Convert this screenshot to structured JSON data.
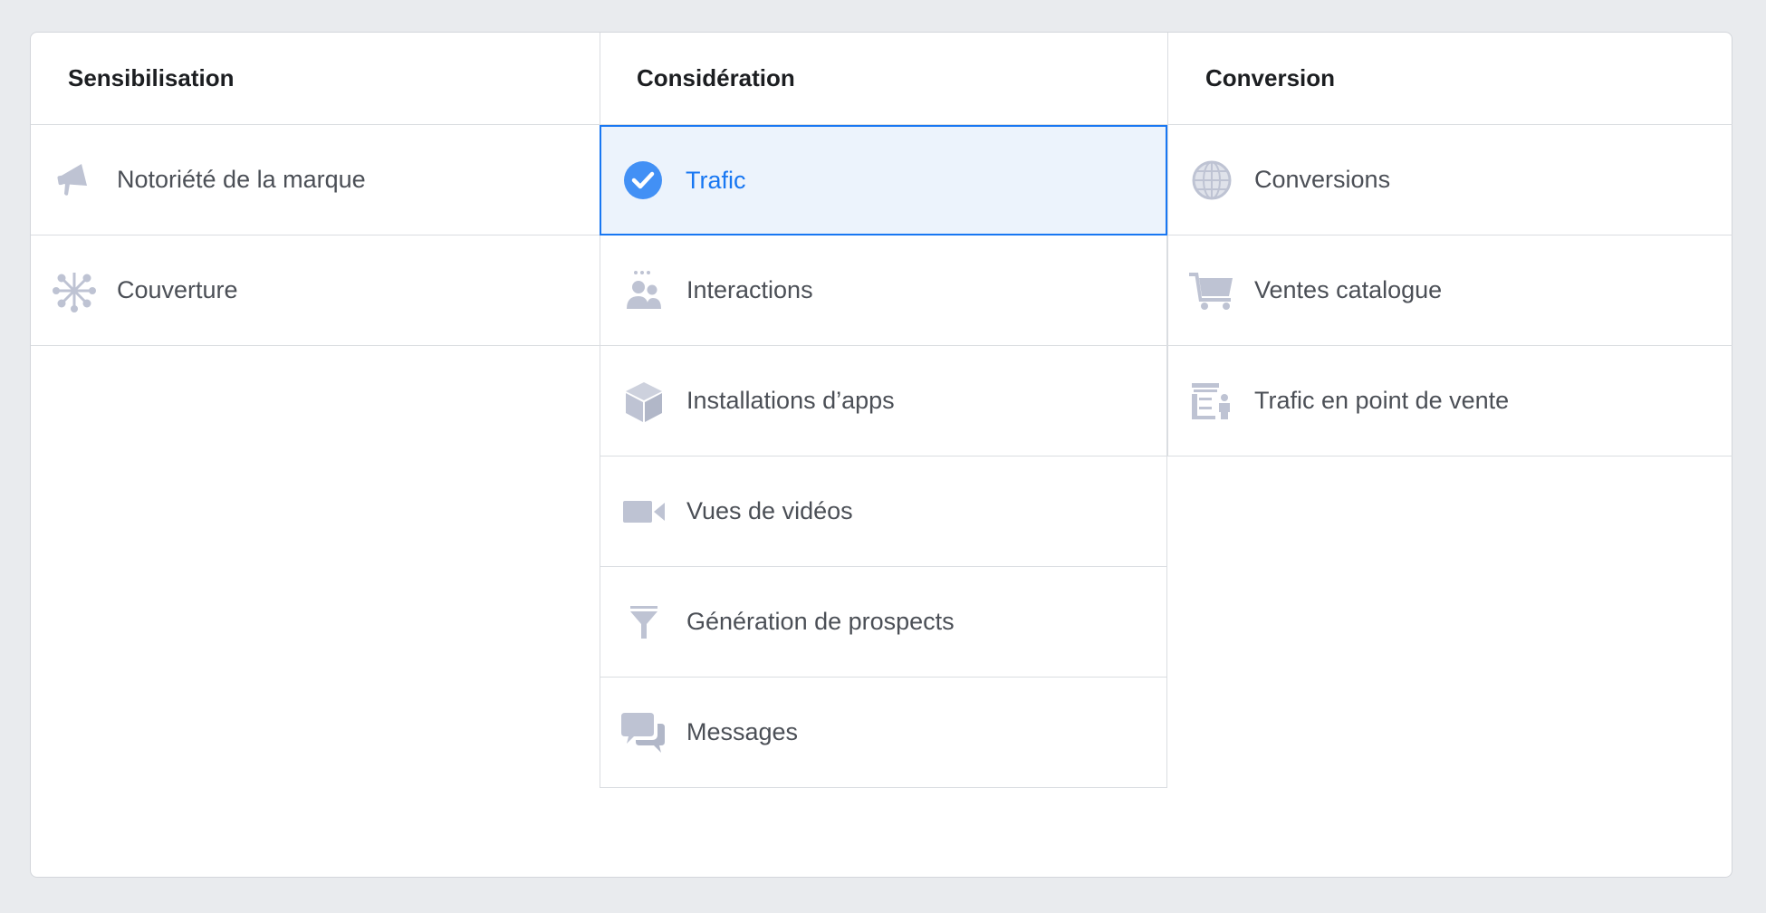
{
  "columns": [
    {
      "header": "Sensibilisation",
      "items": [
        {
          "label": "Notoriété de la marque",
          "icon": "megaphone-icon",
          "selected": false
        },
        {
          "label": "Couverture",
          "icon": "network-icon",
          "selected": false
        }
      ]
    },
    {
      "header": "Considération",
      "items": [
        {
          "label": "Trafic",
          "icon": "check-circle-icon",
          "selected": true
        },
        {
          "label": "Interactions",
          "icon": "people-icon",
          "selected": false
        },
        {
          "label": "Installations d’apps",
          "icon": "box-icon",
          "selected": false
        },
        {
          "label": "Vues de vidéos",
          "icon": "video-camera-icon",
          "selected": false
        },
        {
          "label": "Génération de prospects",
          "icon": "funnel-icon",
          "selected": false
        },
        {
          "label": "Messages",
          "icon": "chat-bubbles-icon",
          "selected": false
        }
      ]
    },
    {
      "header": "Conversion",
      "items": [
        {
          "label": "Conversions",
          "icon": "globe-icon",
          "selected": false
        },
        {
          "label": "Ventes catalogue",
          "icon": "shopping-cart-icon",
          "selected": false
        },
        {
          "label": "Trafic en point de vente",
          "icon": "store-icon",
          "selected": false
        }
      ]
    }
  ],
  "colors": {
    "accent": "#1877f2",
    "selected_bg": "#ecf3fc",
    "icon": "#bec3d3",
    "text": "#4b4f56",
    "header_text": "#1c1e21"
  }
}
